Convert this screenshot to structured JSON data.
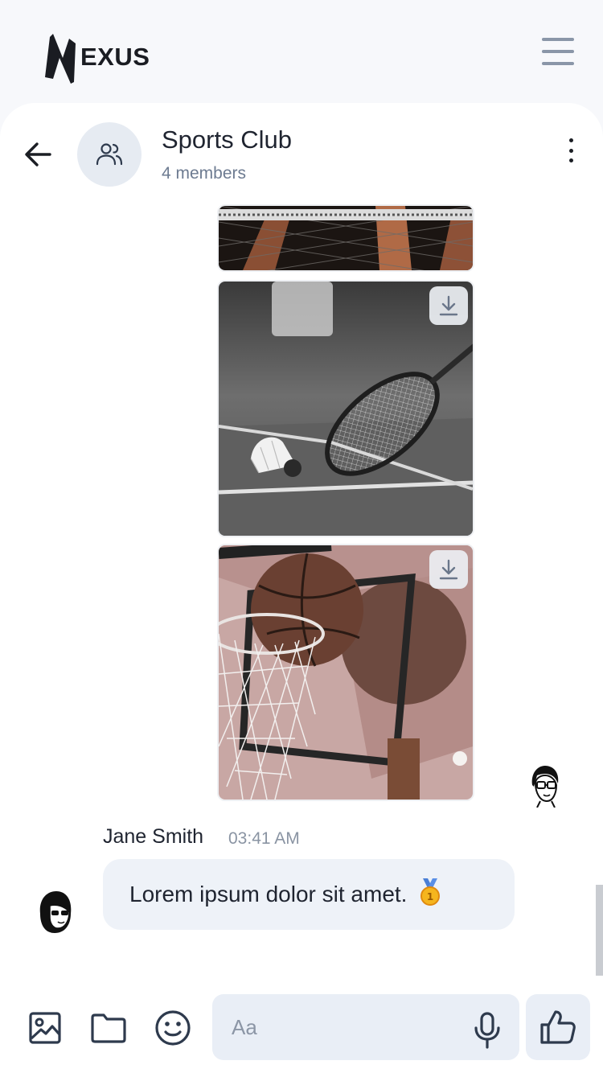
{
  "app": {
    "logo_text": "EXUS"
  },
  "chat": {
    "title": "Sports Club",
    "subtitle": "4 members"
  },
  "messages": {
    "images": [
      {
        "subject": "net-and-arms",
        "alt": "volleyball net photo"
      },
      {
        "subject": "badminton",
        "alt": "badminton racket and shuttlecock photo"
      },
      {
        "subject": "basketball",
        "alt": "basketball in hoop photo"
      }
    ],
    "text_message": {
      "sender": "Jane Smith",
      "time": "03:41 AM",
      "text": "Lorem ipsum dolor sit amet.",
      "emoji": "🥇"
    }
  },
  "composer": {
    "placeholder": "Aa"
  },
  "icons": {
    "menu": "hamburger-icon",
    "back": "arrow-left-icon",
    "group": "users-icon",
    "more": "more-vertical-icon",
    "download": "download-icon",
    "image": "image-icon",
    "folder": "folder-icon",
    "emoji": "smile-icon",
    "mic": "microphone-icon",
    "like": "thumbs-up-icon"
  },
  "colors": {
    "bubble": "#eef2f8",
    "accent_grey": "#8a96a8",
    "icon_dark": "#2e3a4d"
  }
}
